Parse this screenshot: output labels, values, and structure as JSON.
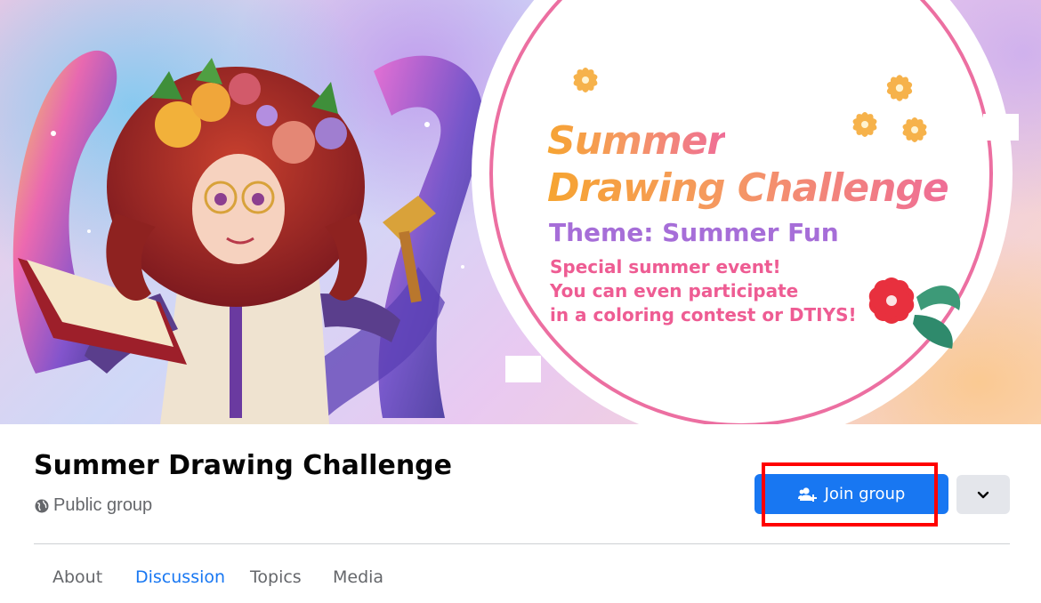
{
  "cover": {
    "title_line_1": "Summer",
    "title_line_2": "Drawing Challenge",
    "theme": "Theme: Summer Fun",
    "description_lines": [
      "Special summer event!",
      "You can even participate",
      "in a coloring contest or DTIYS!"
    ]
  },
  "group": {
    "name": "Summer Drawing Challenge",
    "privacy": "Public group",
    "privacy_icon": "globe-icon"
  },
  "actions": {
    "join_label": "Join group",
    "join_icon": "people-add-icon",
    "more_icon": "chevron-down-icon"
  },
  "tabs": [
    {
      "label": "About",
      "active": false
    },
    {
      "label": "Discussion",
      "active": true
    },
    {
      "label": "Topics",
      "active": false
    },
    {
      "label": "Media",
      "active": false
    }
  ],
  "colors": {
    "accent": "#1877f2",
    "highlight": "#ff0000",
    "title_gradient_start": "#f6a431",
    "title_gradient_end": "#ef6d97",
    "theme_text": "#a66ed8",
    "description_text": "#ee5c93"
  }
}
